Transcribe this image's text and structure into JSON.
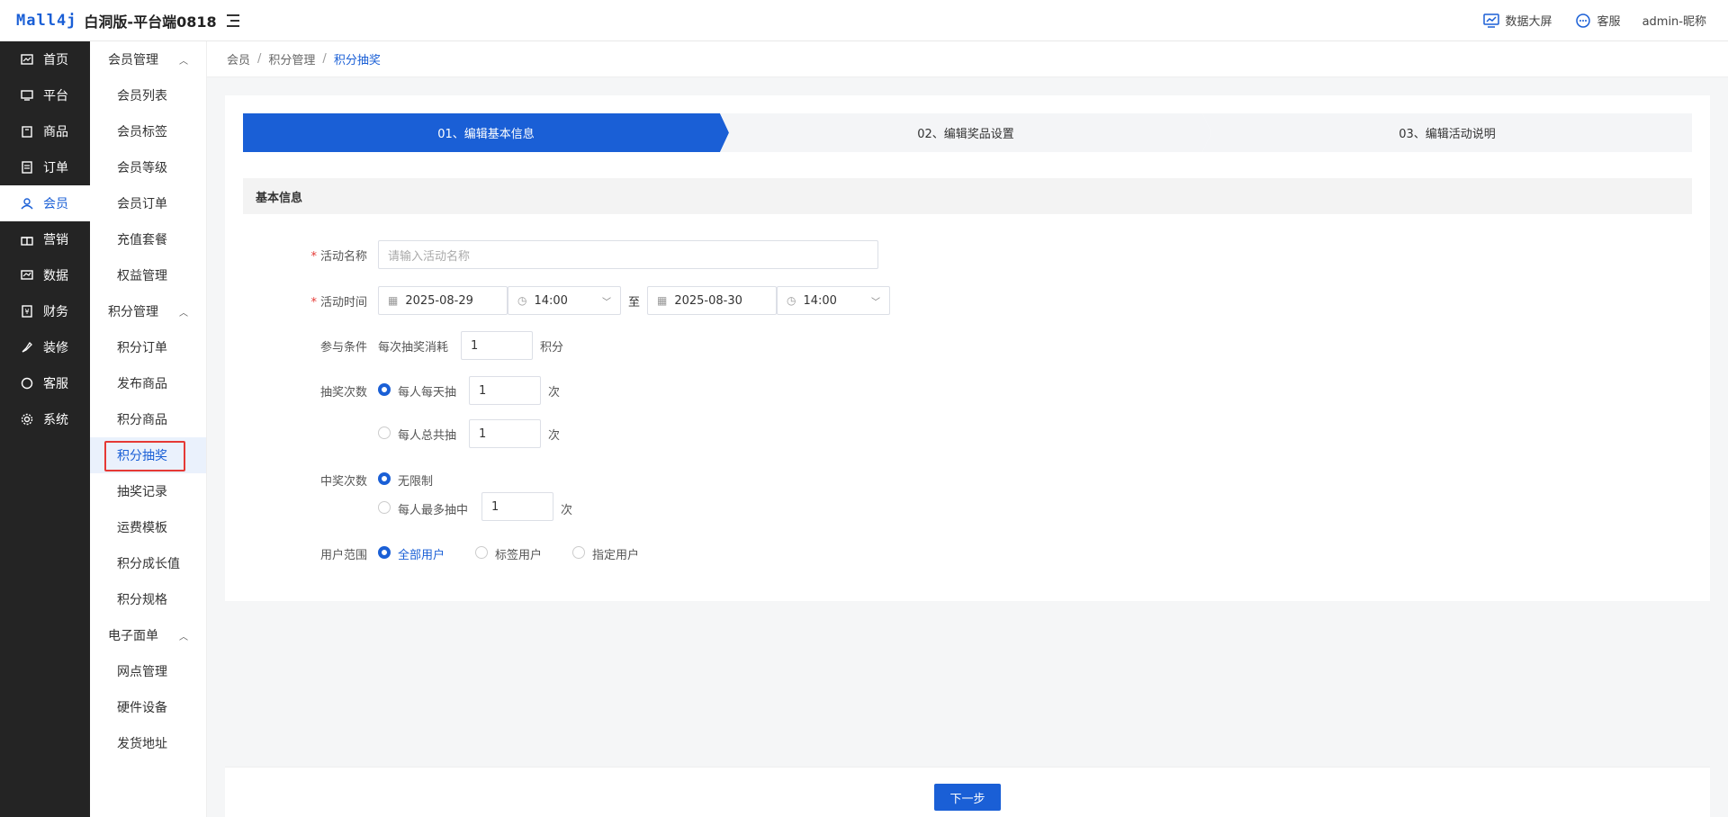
{
  "header": {
    "logo": "Mall4j",
    "title": "白洞版-平台端0818",
    "data_screen": "数据大屏",
    "service": "客服",
    "user": "admin-昵称"
  },
  "sidebar": {
    "items": [
      {
        "label": "首页",
        "icon": "dashboard-icon"
      },
      {
        "label": "平台",
        "icon": "monitor-icon"
      },
      {
        "label": "商品",
        "icon": "bag-icon"
      },
      {
        "label": "订单",
        "icon": "document-icon"
      },
      {
        "label": "会员",
        "icon": "users-icon",
        "active": true
      },
      {
        "label": "营销",
        "icon": "gift-icon"
      },
      {
        "label": "数据",
        "icon": "chart-icon"
      },
      {
        "label": "财务",
        "icon": "finance-icon"
      },
      {
        "label": "装修",
        "icon": "paint-icon"
      },
      {
        "label": "客服",
        "icon": "chat-icon"
      },
      {
        "label": "系统",
        "icon": "gear-icon"
      }
    ]
  },
  "submenu": {
    "group1": "会员管理",
    "group1_items": [
      "会员列表",
      "会员标签",
      "会员等级",
      "会员订单",
      "充值套餐",
      "权益管理"
    ],
    "group2": "积分管理",
    "group2_items": [
      "积分订单",
      "发布商品",
      "积分商品",
      "积分抽奖",
      "抽奖记录",
      "运费模板",
      "积分成长值",
      "积分规格"
    ],
    "group3": "电子面单",
    "group3_items": [
      "网点管理",
      "硬件设备",
      "发货地址"
    ]
  },
  "breadcrumb": {
    "level1": "会员",
    "level2": "积分管理",
    "current": "积分抽奖",
    "sep": "/"
  },
  "steps": [
    {
      "label": "01、编辑基本信息",
      "active": true
    },
    {
      "label": "02、编辑奖品设置",
      "active": false
    },
    {
      "label": "03、编辑活动说明",
      "active": false
    }
  ],
  "section_title": "基本信息",
  "form": {
    "name_label": "活动名称",
    "name_placeholder": "请输入活动名称",
    "time_label": "活动时间",
    "start_date": "2025-08-29",
    "start_time": "14:00",
    "to": "至",
    "end_date": "2025-08-30",
    "end_time": "14:00",
    "cond_label": "参与条件",
    "cond_prefix": "每次抽奖消耗",
    "cond_value": "1",
    "cond_unit": "积分",
    "draw_label": "抽奖次数",
    "draw_opt1": "每人每天抽",
    "draw_opt1_value": "1",
    "draw_opt2": "每人总共抽",
    "draw_opt2_value": "1",
    "times_unit": "次",
    "win_label": "中奖次数",
    "win_opt1": "无限制",
    "win_opt2": "每人最多抽中",
    "win_opt2_value": "1",
    "scope_label": "用户范围",
    "scope_opt1": "全部用户",
    "scope_opt2": "标签用户",
    "scope_opt3": "指定用户"
  },
  "footer": {
    "next": "下一步"
  },
  "colors": {
    "primary": "#1a5fd6",
    "sidebar_bg": "#242424",
    "annotation": "#e53935"
  }
}
